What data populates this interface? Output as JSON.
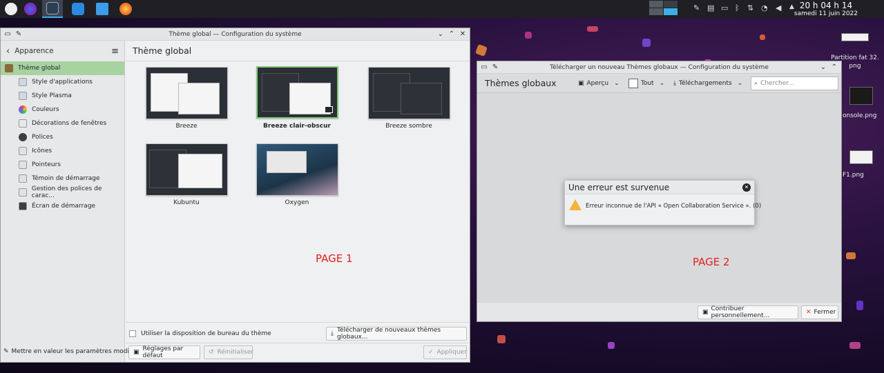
{
  "taskbar": {
    "apps": [
      "app-launcher-icon",
      "firefox-dev-icon",
      "system-settings-icon",
      "discover-icon",
      "dolphin-icon",
      "firefox-icon"
    ],
    "clock_time": "20 h 04 h 14",
    "clock_date": "samedi 11 juin 2022"
  },
  "desktop": {
    "icons": [
      "Partition fat 32.",
      "png",
      "onsole.png",
      "F1.png"
    ]
  },
  "win1": {
    "title": "Thème global — Configuration du système",
    "back_label": "Apparence",
    "header": "Thème global",
    "sidebar_items": [
      "Thème global",
      "Style d'applications",
      "Style Plasma",
      "Couleurs",
      "Décorations de fenêtres",
      "Polices",
      "Icônes",
      "Pointeurs",
      "Témoin de démarrage",
      "Gestion des polices de carac...",
      "Écran de démarrage"
    ],
    "highlight_changed": "Mettre en valeur les paramètres modifié",
    "themes": [
      "Breeze",
      "Breeze clair-obscur",
      "Breeze sombre",
      "Kubuntu",
      "Oxygen"
    ],
    "selected_theme": "Breeze clair-obscur",
    "use_layout_label": "Utiliser la disposition de bureau du thème",
    "download_button": "Télécharger de nouveaux thèmes globaux...",
    "defaults_button": "Réglages par défaut",
    "reset_button": "Réinitialiser",
    "apply_button": "Appliquer",
    "page_label": "PAGE 1"
  },
  "win2": {
    "title": "Télécharger un nouveau Thèmes globaux — Configuration du système",
    "heading": "Thèmes globaux",
    "preview_label": "Aperçu",
    "filter_label": "Tout",
    "downloads_label": "Téléchargements",
    "search_placeholder": "Chercher...",
    "error_title": "Une erreur est survenue",
    "error_message": "Erreur inconnue de l'API « Open Collaboration Service ». (0)",
    "contribute_button": "Contribuer personnellement...",
    "close_button": "Fermer",
    "page_label": "PAGE 2"
  },
  "colors": {
    "accent": "#3daee9",
    "selection": "#a9d2a1",
    "warning": "#f3b43b",
    "page_label": "#e02020"
  }
}
